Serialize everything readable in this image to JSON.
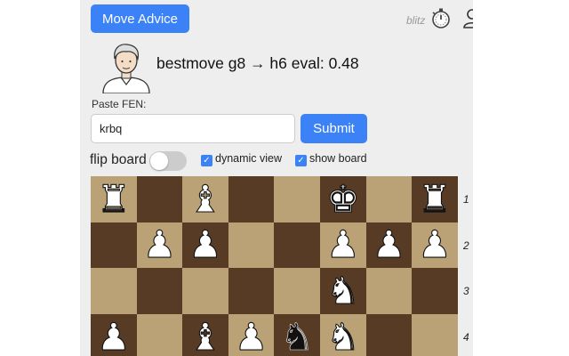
{
  "header": {
    "move_advice_label": "Move Advice",
    "mode_label": "blitz",
    "timer_icon": "stopwatch-icon",
    "user_icon": "user-icon"
  },
  "engine": {
    "bestmove_text": "bestmove g8 → h6 eval: 0.48"
  },
  "fen": {
    "label": "Paste FEN:",
    "value": "krbq",
    "submit_label": "Submit"
  },
  "options": {
    "flip_label": "flip board",
    "flip_on": false,
    "dynamic_label": "dynamic view",
    "dynamic_checked": true,
    "show_label": "show board",
    "show_checked": true
  },
  "board": {
    "rank_labels": [
      "1",
      "2",
      "3",
      "4"
    ],
    "rows": [
      [
        "wR",
        "",
        "wB",
        "",
        "",
        "wK",
        "",
        "wR"
      ],
      [
        "",
        "wP",
        "wP",
        "",
        "",
        "wP",
        "wP",
        "wP"
      ],
      [
        "",
        "",
        "",
        "",
        "",
        "wN",
        "",
        ""
      ],
      [
        "wP",
        "",
        "wB",
        "wP",
        "bN",
        "wN",
        "",
        ""
      ]
    ]
  },
  "colors": {
    "accent": "#3b82f6",
    "light_square": "#bba276",
    "dark_square": "#573b25",
    "panel": "#eeeeee"
  }
}
